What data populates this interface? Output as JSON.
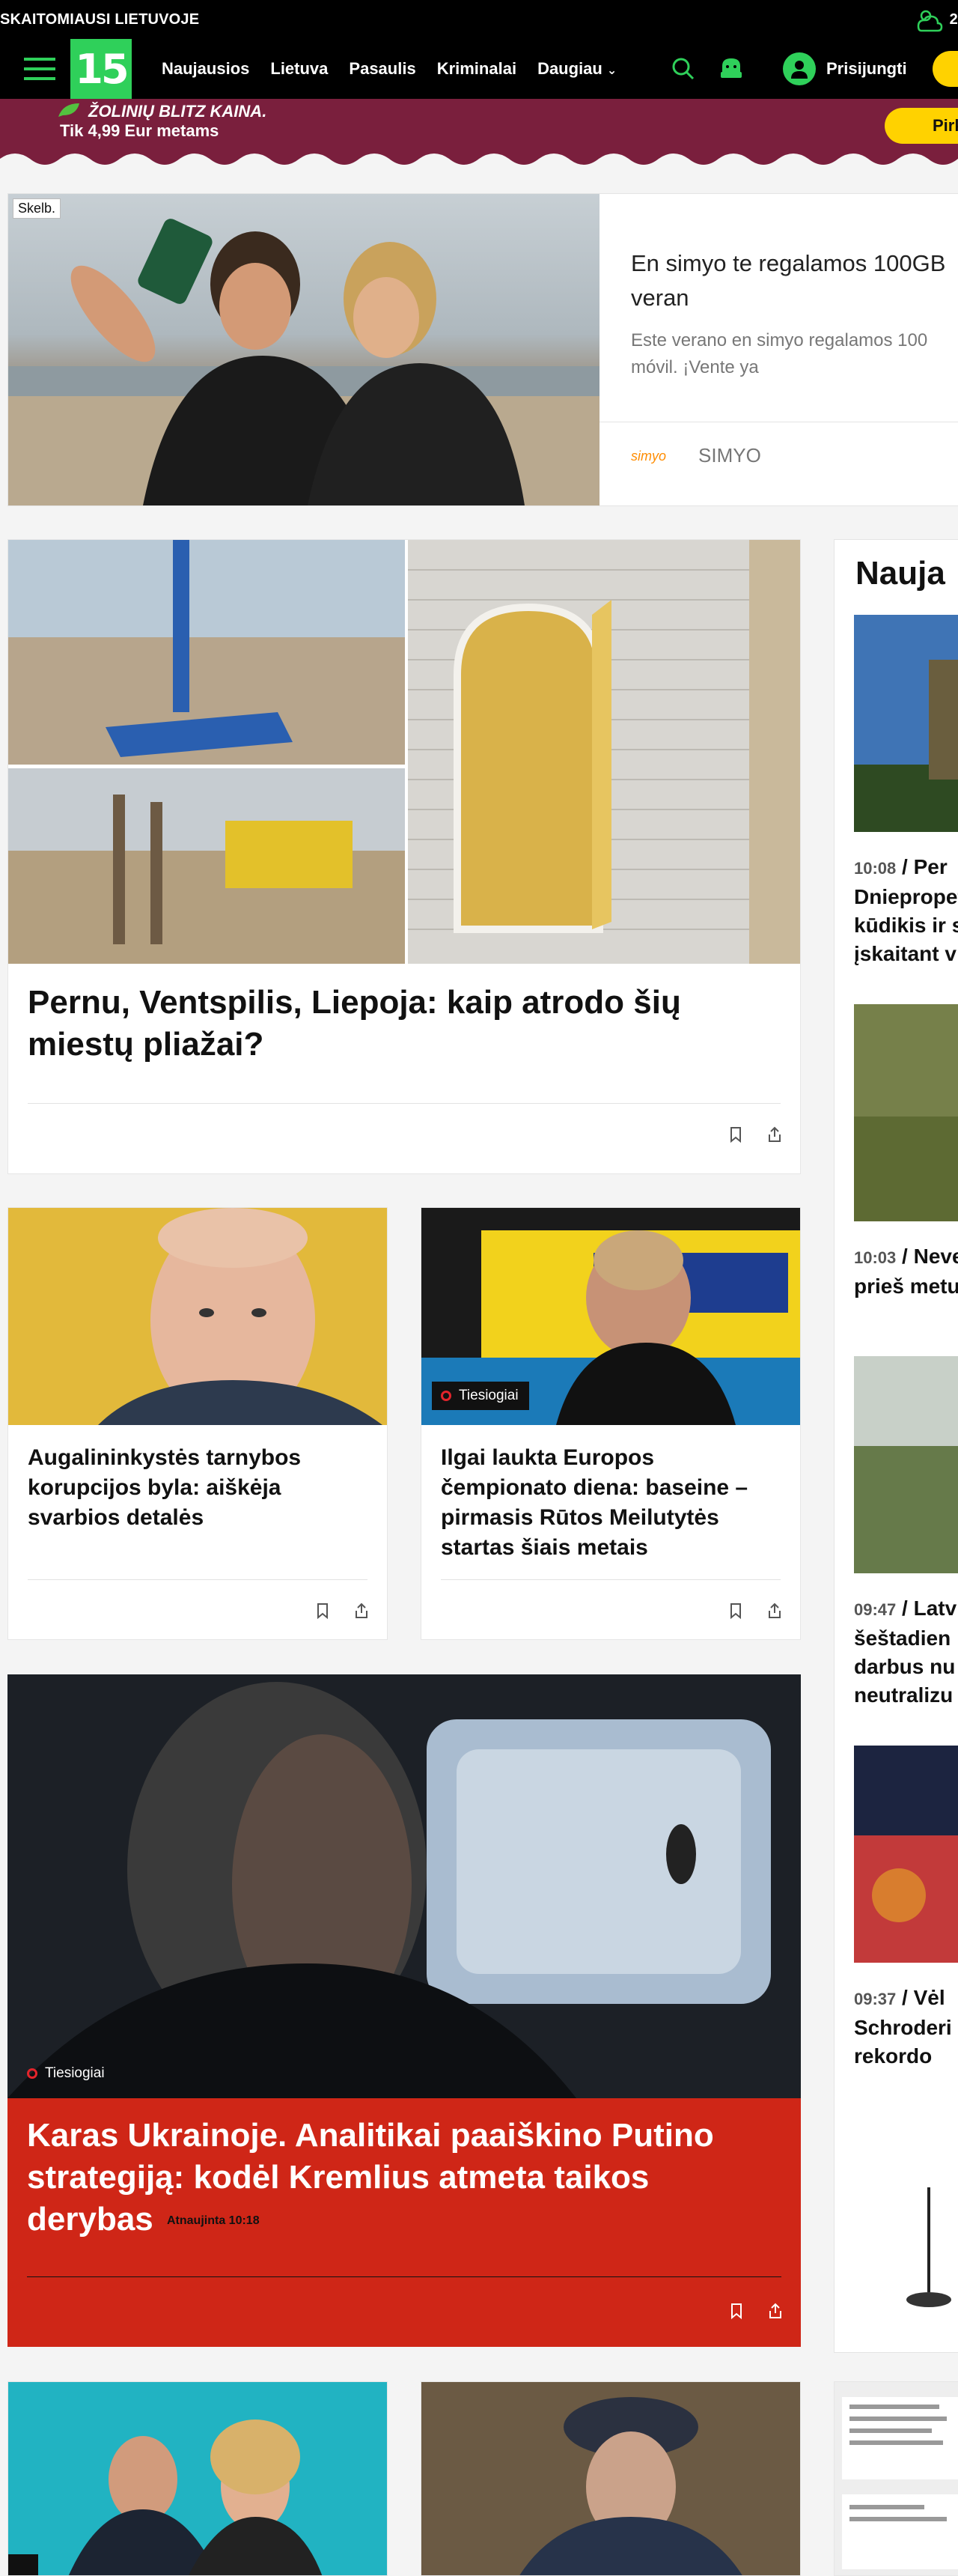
{
  "topbar": {
    "left_text": "SKAITOMIAUSI LIETUVOJE",
    "weather_temp": "2"
  },
  "nav": {
    "logo_text": "15",
    "links": [
      "Naujausios",
      "Lietuva",
      "Pasaulis",
      "Kriminalai",
      "Daugiau"
    ],
    "login_label": "Prisijungti"
  },
  "promo": {
    "line1": "ŽOLINIŲ BLITZ KAINA.",
    "line2": "Tik 4,99 Eur metams",
    "button_label": "Pirk"
  },
  "ad": {
    "badge": "Skelb.",
    "title": "En simyo te regalamos 100GB veran",
    "description": "Este verano en simyo regalamos 100 móvil. ¡Vente ya",
    "brand_mark": "simyo",
    "brand_name": "SIMYO"
  },
  "articles": {
    "main": {
      "title": "Pernu, Ventspilis, Liepoja: kaip atrodo šių miestų pliažai?"
    },
    "card2": {
      "title": "Augalininkystės tarnybos korupcijos byla: aiškėja svarbios detalės"
    },
    "card3": {
      "title": "Ilgai laukta Europos čempionato diena: baseine – pirmasis Rūtos Meilutytės startas šiais metais",
      "badge": "Tiesiogiai"
    },
    "big_red": {
      "badge": "Tiesiogiai",
      "title": "Karas Ukrainoje. Analitikai paaiškino Putino strategiją: kodėl Kremlius atmeta taikos derybas",
      "updated": "Atnaujinta 10:18"
    }
  },
  "sidebar": {
    "heading": "Nauja",
    "items": [
      {
        "time": "10:08",
        "text": "Per Dniepropet kūdikis ir s įskaitant v"
      },
      {
        "time": "10:03",
        "text": "Neve prieš metu"
      },
      {
        "time": "09:47",
        "text": "Latv šeštadien darbus nu neutralizu"
      },
      {
        "time": "09:37",
        "text": "Vėl Schroderi rekordo"
      }
    ]
  },
  "colors": {
    "brand_green": "#2fd05a",
    "promo_bg": "#7a1f3d",
    "accent_yellow": "#ffd200",
    "live_red": "#cf2617"
  }
}
